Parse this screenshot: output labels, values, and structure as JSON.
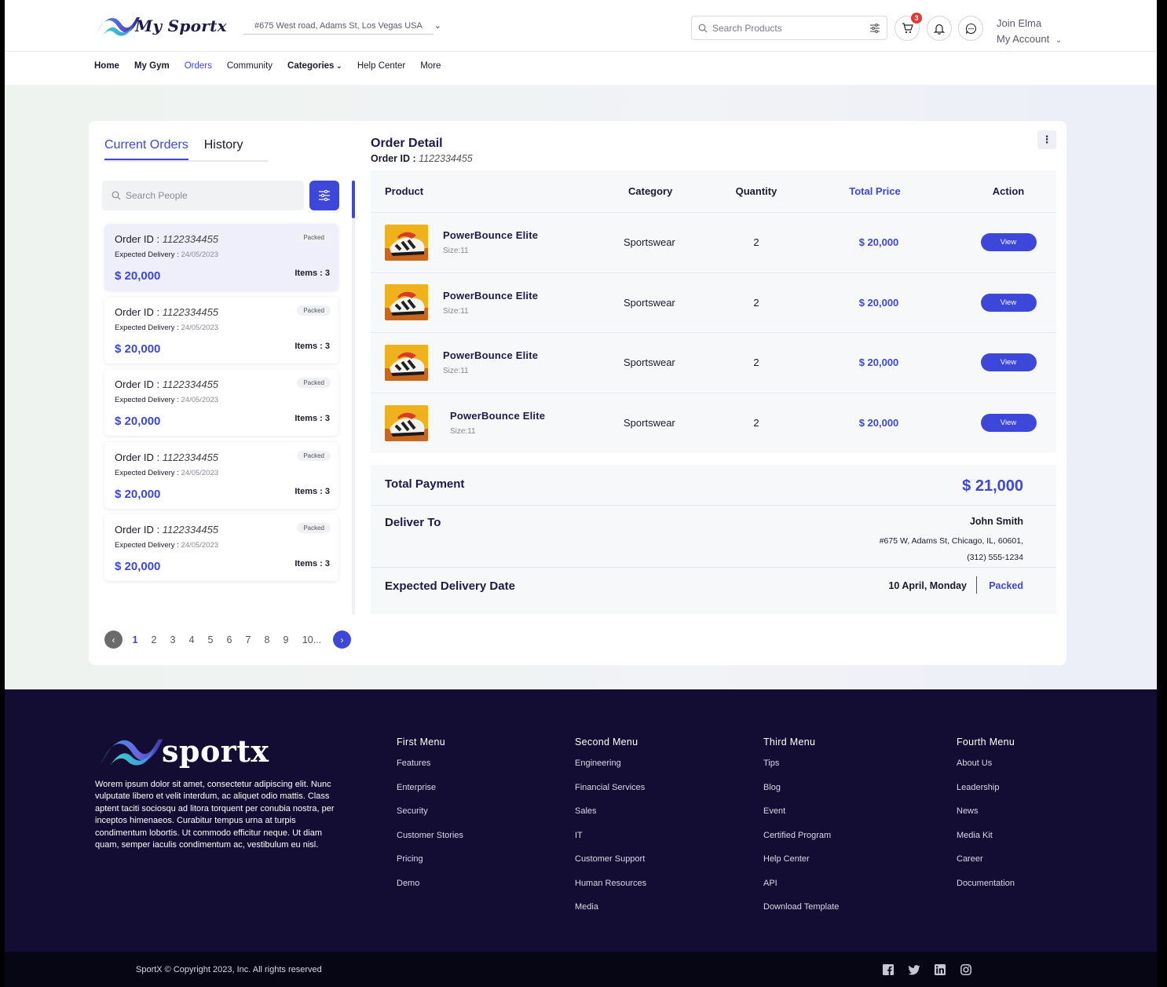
{
  "header": {
    "brand": "My Sportx",
    "address": "#675 West road, Adams St, Los Vegas USA",
    "search_placeholder": "Search Products",
    "cart_count": "3",
    "account_greeting": "Join Elma",
    "account_label": "My Account"
  },
  "nav": {
    "items": [
      {
        "label": "Home"
      },
      {
        "label": "My Gym"
      },
      {
        "label": "Orders"
      },
      {
        "label": "Community"
      },
      {
        "label": "Categories"
      },
      {
        "label": "Help Center"
      },
      {
        "label": "More"
      }
    ],
    "active": "Orders"
  },
  "orders_panel": {
    "tabs": [
      "Current Orders",
      "History"
    ],
    "search_placeholder": "Search People",
    "orders": [
      {
        "id_label": "Order ID :",
        "id": "1122334455",
        "status": "Packed",
        "delivery_label": "Expected Delivery :",
        "delivery": "24/05/2023",
        "price": "$ 20,000",
        "items": "Items : 3"
      },
      {
        "id_label": "Order ID :",
        "id": "1122334455",
        "status": "Packed",
        "delivery_label": "Expected Delivery :",
        "delivery": "24/05/2023",
        "price": "$ 20,000",
        "items": "Items : 3"
      },
      {
        "id_label": "Order ID :",
        "id": "1122334455",
        "status": "Packed",
        "delivery_label": "Expected Delivery :",
        "delivery": "24/05/2023",
        "price": "$ 20,000",
        "items": "Items : 3"
      },
      {
        "id_label": "Order ID :",
        "id": "1122334455",
        "status": "Packed",
        "delivery_label": "Expected Delivery :",
        "delivery": "24/05/2023",
        "price": "$ 20,000",
        "items": "Items : 3"
      },
      {
        "id_label": "Order ID :",
        "id": "1122334455",
        "status": "Packed",
        "delivery_label": "Expected Delivery :",
        "delivery": "24/05/2023",
        "price": "$ 20,000",
        "items": "Items : 3"
      }
    ],
    "pagination": [
      "1",
      "2",
      "3",
      "4",
      "5",
      "6",
      "7",
      "8",
      "9",
      "10..."
    ]
  },
  "order_detail": {
    "title": "Order Detail",
    "id_label": "Order ID :",
    "id": "1122334455",
    "columns": [
      "Product",
      "Category",
      "Quantity",
      "Total Price",
      "Action"
    ],
    "rows": [
      {
        "name": "PowerBounce Elite",
        "size": "Size:11",
        "category": "Sportswear",
        "quantity": "2",
        "price": "$ 20,000",
        "action": "View"
      },
      {
        "name": "PowerBounce Elite",
        "size": "Size:11",
        "category": "Sportswear",
        "quantity": "2",
        "price": "$ 20,000",
        "action": "View"
      },
      {
        "name": "PowerBounce Elite",
        "size": "Size:11",
        "category": "Sportswear",
        "quantity": "2",
        "price": "$ 20,000",
        "action": "View"
      },
      {
        "name": "PowerBounce Elite",
        "size": "Size:11",
        "category": "Sportswear",
        "quantity": "2",
        "price": "$ 20,000",
        "action": "View"
      }
    ],
    "total_label": "Total Payment",
    "total_value": "$ 21,000",
    "deliver_label": "Deliver To",
    "deliver_name": "John Smith",
    "deliver_address": "#675 W, Adams St, Chicago, IL, 60601,",
    "deliver_phone": "(312) 555-1234",
    "expected_label": "Expected Delivery Date",
    "expected_date": "10 April, Monday",
    "expected_status": "Packed"
  },
  "footer": {
    "brand": "sportx",
    "description": "Worem ipsum dolor sit amet, consectetur adipiscing elit. Nunc vulputate libero et velit interdum, ac aliquet odio mattis. Class aptent taciti sociosqu ad litora torquent per conubia nostra, per inceptos himenaeos. Curabitur tempus urna at turpis condimentum lobortis. Ut commodo efficitur neque. Ut diam quam, semper iaculis condimentum ac, vestibulum eu nisl.",
    "columns": [
      {
        "title": "First Menu",
        "links": [
          "Features",
          "Enterprise",
          "Security",
          "Customer Stories",
          "Pricing",
          "Demo"
        ]
      },
      {
        "title": "Second Menu",
        "links": [
          "Engineering",
          "Financial Services",
          "Sales",
          "IT",
          "Customer Support",
          "Human Resources",
          "Media"
        ]
      },
      {
        "title": "Third Menu",
        "links": [
          "Tips",
          "Blog",
          "Event",
          "Certified Program",
          "Help Center",
          "API",
          "Download Template"
        ]
      },
      {
        "title": "Fourth Menu",
        "links": [
          "About Us",
          "Leadership",
          "News",
          "Media Kit",
          "Career",
          "Documentation"
        ]
      }
    ],
    "copyright": "SportX © Copyright 2023, Inc. All rights reserved",
    "socials": [
      "facebook-icon",
      "twitter-icon",
      "linkedin-icon",
      "instagram-icon"
    ]
  },
  "colors": {
    "accent": "#3d47d9",
    "footer_bg": "#130d33",
    "bottom_bar": "#060614"
  }
}
